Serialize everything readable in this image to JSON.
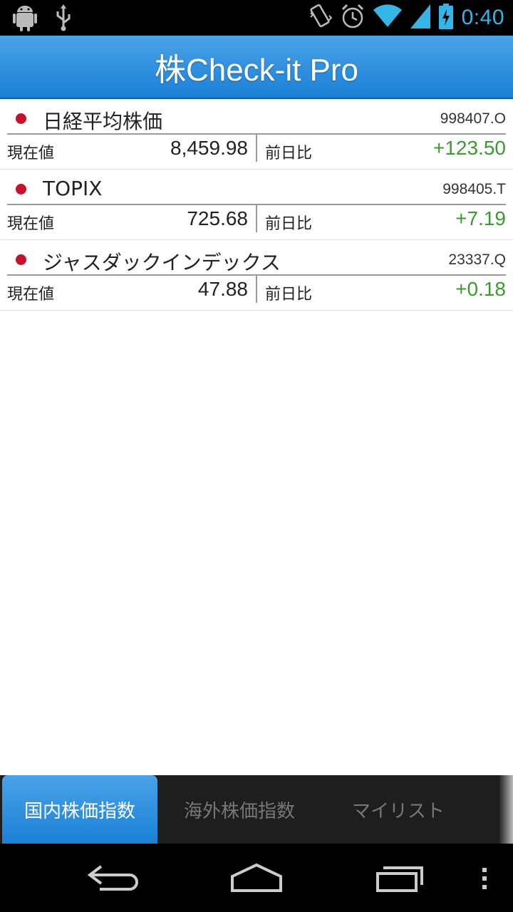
{
  "status_bar": {
    "time": "0:40",
    "icons": [
      "android-debug-icon",
      "usb-icon",
      "vibrate-icon",
      "alarm-icon",
      "wifi-icon",
      "signal-icon",
      "battery-charging-icon"
    ],
    "accent_color": "#33b5e5"
  },
  "app": {
    "title": "株Check-it Pro",
    "accent_color": "#1a80d6"
  },
  "indices": [
    {
      "name": "日経平均株価",
      "code": "998407.O",
      "current_label": "現在値",
      "current_value": "8,459.98",
      "change_label": "前日比",
      "change_value": "+123.50"
    },
    {
      "name": "TOPIX",
      "code": "998405.T",
      "current_label": "現在値",
      "current_value": "725.68",
      "change_label": "前日比",
      "change_value": "+7.19"
    },
    {
      "name": "ジャスダックインデックス",
      "code": "23337.Q",
      "current_label": "現在値",
      "current_value": "47.88",
      "change_label": "前日比",
      "change_value": "+0.18"
    }
  ],
  "colors": {
    "positive_change": "#3a9b2e",
    "flag_dot": "#c8102e"
  },
  "tabs": [
    {
      "label": "国内株価指数",
      "active": true
    },
    {
      "label": "海外株価指数",
      "active": false
    },
    {
      "label": "マイリスト",
      "active": false
    }
  ],
  "nav_bar": {
    "buttons": [
      "back-icon",
      "home-icon",
      "recent-apps-icon",
      "menu-icon"
    ]
  }
}
